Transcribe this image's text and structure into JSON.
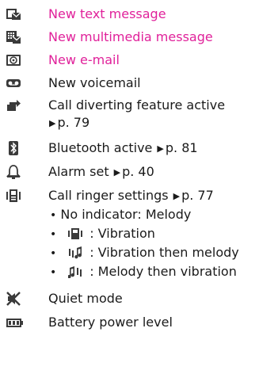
{
  "colors": {
    "highlight": "#e0219a",
    "text": "#1a1a1a",
    "icon": "#3a3a3a"
  },
  "items": [
    {
      "icon": "sms-envelope-icon",
      "label": "New text message"
    },
    {
      "icon": "mms-message-icon",
      "label": "New multimedia message"
    },
    {
      "icon": "email-icon",
      "label": "New e-mail"
    },
    {
      "icon": "voicemail-icon",
      "label": "New voicemail"
    },
    {
      "icon": "call-divert-icon",
      "label": "Call diverting feature active",
      "ref": "p. 79"
    },
    {
      "icon": "bluetooth-icon",
      "label": "Bluetooth active",
      "ref": "p. 81"
    },
    {
      "icon": "alarm-bell-icon",
      "label": "Alarm set",
      "ref": "p. 40"
    },
    {
      "icon": "ringer-settings-icon",
      "label": "Call ringer settings",
      "ref": "p. 77"
    },
    {
      "icon": "quiet-mode-icon",
      "label": "Quiet mode"
    },
    {
      "icon": "battery-icon",
      "label": "Battery power level"
    }
  ],
  "ringer_options": [
    {
      "text": "No indicator: Melody"
    },
    {
      "icon": "vibration-icon",
      "text": ": Vibration"
    },
    {
      "icon": "vibration-then-melody-icon",
      "text": ": Vibration then melody"
    },
    {
      "icon": "melody-then-vibration-icon",
      "text": ": Melody then vibration"
    }
  ]
}
